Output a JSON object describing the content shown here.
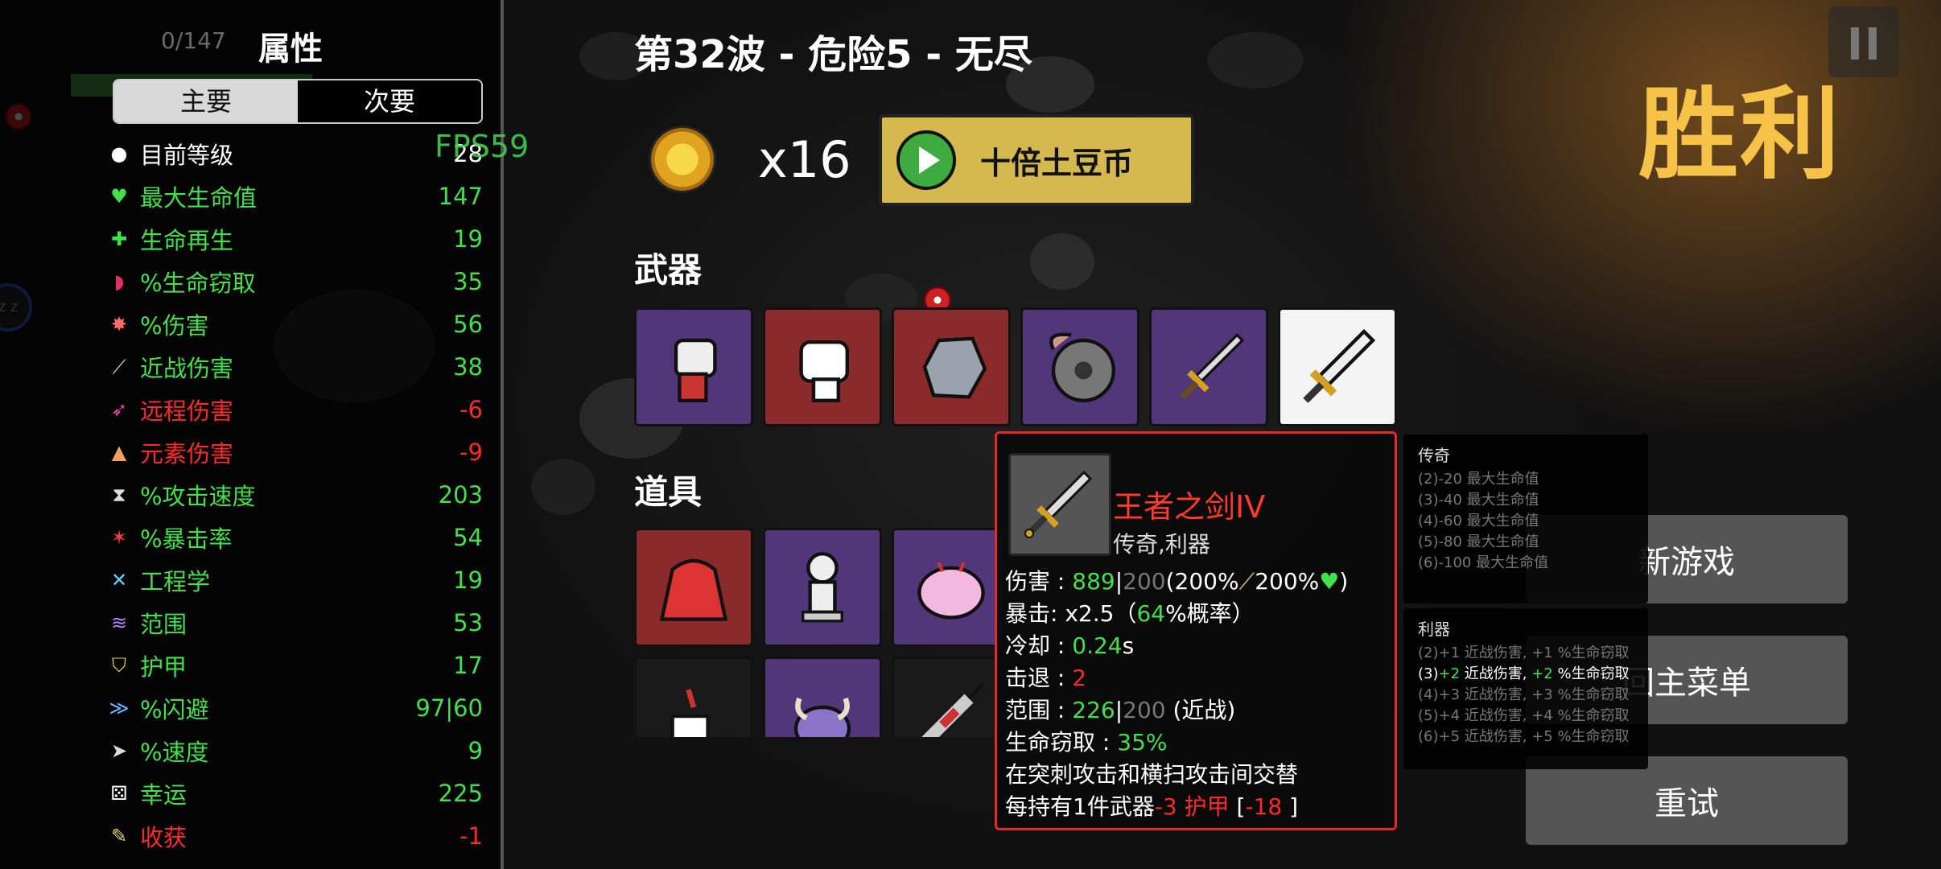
{
  "stats_panel": {
    "title": "属性",
    "tab_primary": "主要",
    "tab_secondary": "次要",
    "fps": "FPS59",
    "bg_counter": "0/147",
    "stats": [
      {
        "icon": "level-icon",
        "label": "目前等级",
        "value": "28",
        "color": "white"
      },
      {
        "icon": "heart-icon",
        "label": "最大生命值",
        "value": "147",
        "color": "green"
      },
      {
        "icon": "regen-icon",
        "label": "生命再生",
        "value": "19",
        "color": "green"
      },
      {
        "icon": "lifesteal-icon",
        "label": "%生命窃取",
        "value": "35",
        "color": "green"
      },
      {
        "icon": "damage-icon",
        "label": "%伤害",
        "value": "56",
        "color": "green"
      },
      {
        "icon": "melee-icon",
        "label": "近战伤害",
        "value": "38",
        "color": "green"
      },
      {
        "icon": "ranged-icon",
        "label": "远程伤害",
        "value": "-6",
        "color": "red"
      },
      {
        "icon": "elemental-icon",
        "label": "元素伤害",
        "value": "-9",
        "color": "red"
      },
      {
        "icon": "attack-speed-icon",
        "label": "%攻击速度",
        "value": "203",
        "color": "green"
      },
      {
        "icon": "crit-icon",
        "label": "%暴击率",
        "value": "54",
        "color": "green"
      },
      {
        "icon": "engineering-icon",
        "label": "工程学",
        "value": "19",
        "color": "green"
      },
      {
        "icon": "range-icon",
        "label": "范围",
        "value": "53",
        "color": "green"
      },
      {
        "icon": "armor-icon",
        "label": "护甲",
        "value": "17",
        "color": "green"
      },
      {
        "icon": "dodge-icon",
        "label": "%闪避",
        "value": "97|60",
        "color": "green"
      },
      {
        "icon": "speed-icon",
        "label": "%速度",
        "value": "9",
        "color": "green"
      },
      {
        "icon": "luck-icon",
        "label": "幸运",
        "value": "225",
        "color": "green"
      },
      {
        "icon": "harvest-icon",
        "label": "收获",
        "value": "-1",
        "color": "red"
      }
    ]
  },
  "header": {
    "wave_title": "第32波 - 危险5 - 无尽",
    "coin_count": "x16",
    "tenx_button": "十倍土豆币"
  },
  "sections": {
    "weapons": "武器",
    "items": "道具"
  },
  "weapons": [
    {
      "name": "power-fist-icon",
      "tier": "purple"
    },
    {
      "name": "fist-icon",
      "tier": "red"
    },
    {
      "name": "rock-icon",
      "tier": "red"
    },
    {
      "name": "sawblade-icon",
      "tier": "purple"
    },
    {
      "name": "sword-icon",
      "tier": "purple"
    },
    {
      "name": "excalibur-icon",
      "tier": "white"
    }
  ],
  "items": [
    {
      "name": "red-hoodie-icon",
      "tier": "red"
    },
    {
      "name": "statue-icon",
      "tier": "purple"
    },
    {
      "name": "brain-icon",
      "tier": "purple"
    },
    {
      "name": "coffee-cup-icon",
      "tier": "dark"
    },
    {
      "name": "horned-creature-icon",
      "tier": "purple"
    },
    {
      "name": "syringe-icon",
      "tier": "dark"
    }
  ],
  "tooltip": {
    "name": "王者之剑IV",
    "type": "传奇,利器",
    "damage_label": "伤害 : ",
    "damage_value": "889",
    "damage_sep": "|",
    "damage_base": "200",
    "damage_scaling_a": "(200%",
    "damage_scaling_b": "200%",
    "damage_close": ")",
    "crit_label": "暴击:  x2.5（",
    "crit_chance": "64",
    "crit_suffix": "%概率）",
    "cooldown_label": "冷却 : ",
    "cooldown_value": "0.24",
    "cooldown_unit": "s",
    "knockback_label": "击退 : ",
    "knockback_value": "2",
    "range_label": "范围 : ",
    "range_value": "226",
    "range_sep": "|",
    "range_base": "200",
    "range_suffix": " (近战)",
    "lifesteal_label": "生命窃取 : ",
    "lifesteal_value": "35%",
    "effect1": "在突刺攻击和横扫攻击间交替",
    "effect2_prefix": "每持有1件武器",
    "effect2_value": "-3 护甲",
    "effect2_open": " [",
    "effect2_total": "-18",
    "effect2_close": " ]"
  },
  "set_bonus_legendary": {
    "title": "传奇",
    "lines": [
      "(2)-20 最大生命值",
      "(3)-40 最大生命值",
      "(4)-60 最大生命值",
      "(5)-80 最大生命值",
      "(6)-100 最大生命值"
    ]
  },
  "set_bonus_sharp": {
    "title": "利器",
    "line1": "(2)+1 近战伤害, +1 %生命窃取",
    "line2_a": "(3)",
    "line2_b": "+2",
    "line2_c": " 近战伤害, ",
    "line2_d": "+2",
    "line2_e": " %生命窃取",
    "line3": "(4)+3 近战伤害, +3 %生命窃取",
    "line4": "(5)+4 近战伤害, +4 %生命窃取",
    "line5": "(6)+5 近战伤害, +5 %生命窃取"
  },
  "right_panel": {
    "victory": "胜利",
    "new_game": "新游戏",
    "main_menu": "回主菜单",
    "retry": "重试"
  },
  "colors": {
    "victory": "#f6c247",
    "stat_green": "#42e04a",
    "stat_red": "#ff2b2b",
    "tooltip_border": "#e22a2a",
    "tenx_button": "#d6b94e"
  }
}
